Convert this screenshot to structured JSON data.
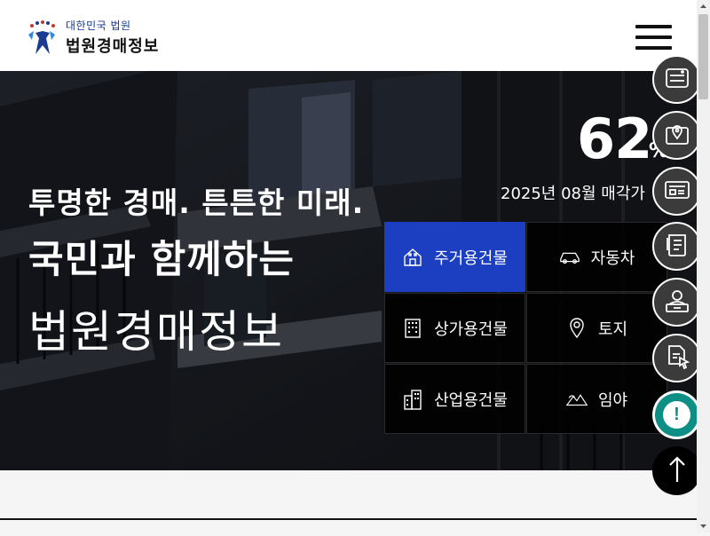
{
  "header": {
    "logo_sub": "대한민국 법원",
    "logo_main": "법원경매정보"
  },
  "hero": {
    "headline1": "투명한 경매. 튼튼한 미래.",
    "headline2": "국민과 함께하는",
    "headline3": "법원경매정보",
    "rate_value": "62",
    "rate_unit": "%",
    "rate_label": "2025년 08월 매각가"
  },
  "categories": [
    {
      "label": "주거용건물",
      "icon": "house-icon",
      "active": true
    },
    {
      "label": "자동차",
      "icon": "car-icon",
      "active": false
    },
    {
      "label": "상가용건물",
      "icon": "building-icon",
      "active": false
    },
    {
      "label": "토지",
      "icon": "map-pin-icon",
      "active": false
    },
    {
      "label": "산업용건물",
      "icon": "factory-icon",
      "active": false
    },
    {
      "label": "임야",
      "icon": "mountain-icon",
      "active": false
    }
  ],
  "side_buttons": [
    "list-icon",
    "map-icon",
    "screen-icon",
    "document-pen-icon",
    "person-desk-icon",
    "file-click-icon"
  ],
  "colors": {
    "accent_blue": "#1b3fc0",
    "alert_teal": "#0e8f86",
    "side_button_bg": "#3b3b3b"
  }
}
